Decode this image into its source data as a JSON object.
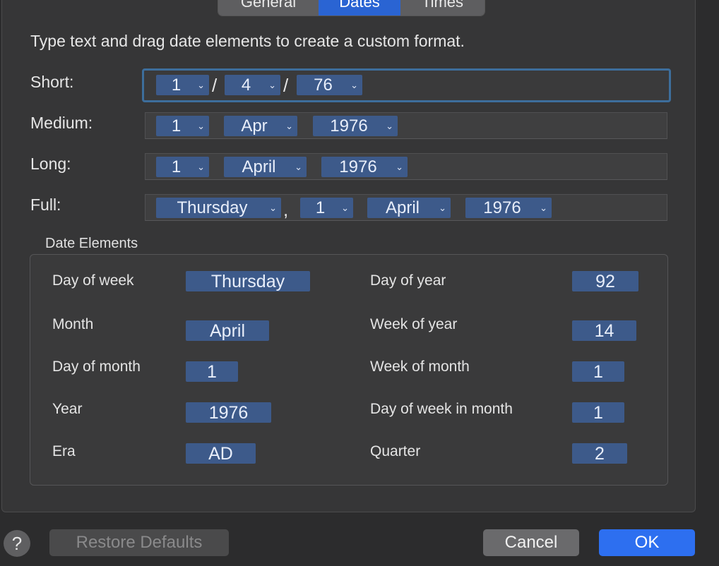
{
  "tabs": [
    {
      "label": "General"
    },
    {
      "label": "Dates"
    },
    {
      "label": "Times"
    }
  ],
  "instruction": "Type text and drag date elements to create a custom format.",
  "formats": {
    "short": {
      "label": "Short:",
      "tokens": [
        "1",
        "4",
        "76"
      ],
      "separators": [
        "/",
        "/"
      ]
    },
    "medium": {
      "label": "Medium:",
      "tokens": [
        "1",
        "Apr",
        "1976"
      ]
    },
    "long": {
      "label": "Long:",
      "tokens": [
        "1",
        "April",
        "1976"
      ]
    },
    "full": {
      "label": "Full:",
      "tokens": [
        "Thursday",
        "1",
        "April",
        "1976"
      ],
      "separators": [
        ","
      ]
    }
  },
  "elements": {
    "title": "Date Elements",
    "day_of_week": {
      "label": "Day of week",
      "value": "Thursday"
    },
    "month": {
      "label": "Month",
      "value": "April"
    },
    "day_of_month": {
      "label": "Day of month",
      "value": "1"
    },
    "year": {
      "label": "Year",
      "value": "1976"
    },
    "era": {
      "label": "Era",
      "value": "AD"
    },
    "day_of_year": {
      "label": "Day of year",
      "value": "92"
    },
    "week_of_year": {
      "label": "Week of year",
      "value": "14"
    },
    "week_of_month": {
      "label": "Week of month",
      "value": "1"
    },
    "day_of_week_in_month": {
      "label": "Day of week in month",
      "value": "1"
    },
    "quarter": {
      "label": "Quarter",
      "value": "2"
    }
  },
  "buttons": {
    "help": "?",
    "restore": "Restore Defaults",
    "cancel": "Cancel",
    "ok": "OK"
  },
  "chevron": "⌄"
}
